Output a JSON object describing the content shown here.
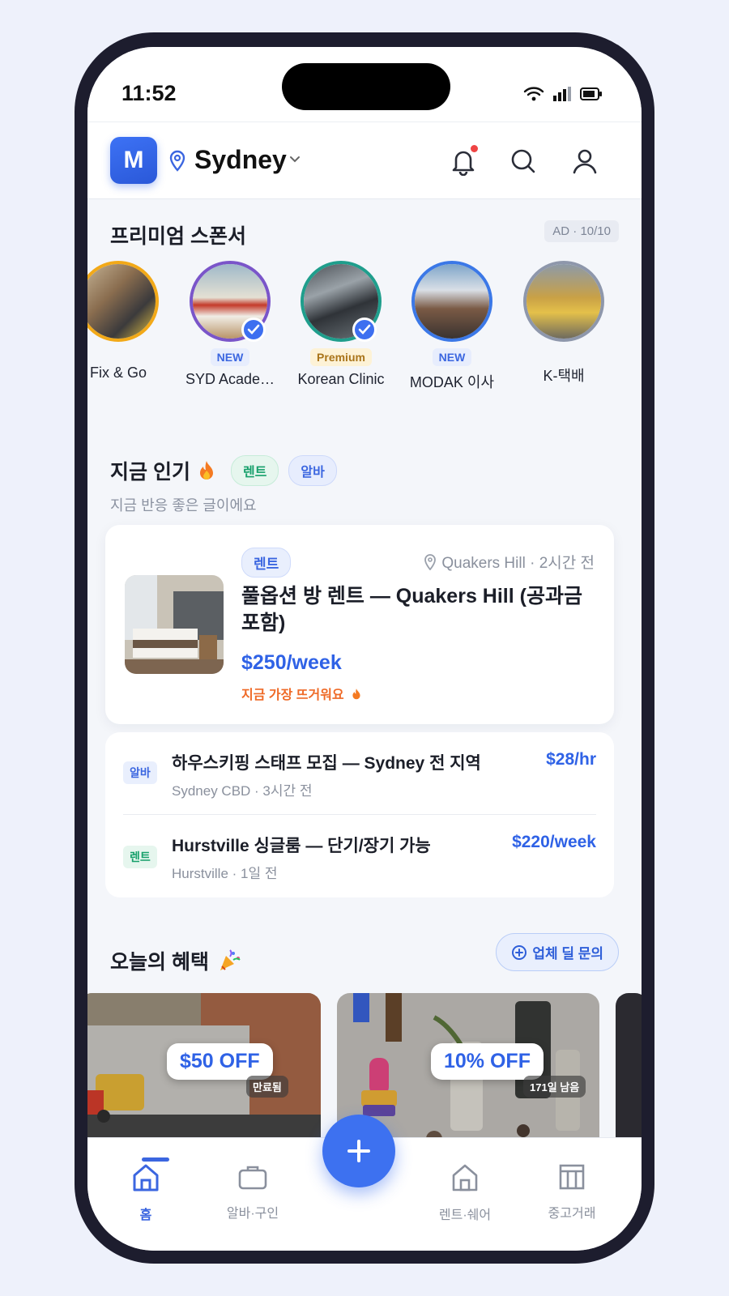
{
  "status_bar": {
    "time": "11:52"
  },
  "header": {
    "logo_letter": "M",
    "city": "Sydney"
  },
  "sponsors": {
    "title": "프리미엄 스폰서",
    "ad_badge": "AD · 10/10",
    "items": [
      {
        "name": "Fix & Go",
        "tag": "",
        "ring": "#f2a918",
        "verified": false
      },
      {
        "name": "SYD Acade…",
        "tag": "NEW",
        "ring": "#7a55c9",
        "verified": true
      },
      {
        "name": "Korean Clinic",
        "tag": "Premium",
        "ring": "#1f9e8c",
        "verified": true
      },
      {
        "name": "MODAK 이사",
        "tag": "NEW",
        "ring": "#3b78e7",
        "verified": false
      },
      {
        "name": "K-택배",
        "tag": "",
        "ring": "#8e97ab",
        "verified": false
      }
    ]
  },
  "popular": {
    "title": "지금 인기",
    "chip_rent": "렌트",
    "chip_alba": "알바",
    "subtitle": "지금 반응 좋은 글이에요",
    "featured": {
      "tag": "렌트",
      "location": "Quakers Hill · 2시간 전",
      "title": "풀옵션 방 렌트 — Quakers Hill (공과금 포함)",
      "price": "$250/week",
      "hot_label": "지금 가장 뜨거워요"
    },
    "list": [
      {
        "tag": "알바",
        "title": "하우스키핑 스태프 모집 — Sydney 전 지역",
        "sub": "Sydney CBD · 3시간 전",
        "price": "$28/hr"
      },
      {
        "tag": "렌트",
        "title": "Hurstville 싱글룸 — 단기/장기 가능",
        "sub": "Hurstville · 1일 전",
        "price": "$220/week"
      }
    ]
  },
  "deals": {
    "title": "오늘의 혜택",
    "inquiry_button": "업체 딜 문의",
    "cards": [
      {
        "offer": "$50 OFF",
        "meta": "만료됨"
      },
      {
        "offer": "10% OFF",
        "meta": "171일 남음"
      }
    ]
  },
  "bottom_nav": {
    "items": [
      {
        "label": "홈",
        "icon": "home-icon",
        "active": true
      },
      {
        "label": "알바·구인",
        "icon": "briefcase-icon",
        "active": false
      },
      {
        "label": "렌트·쉐어",
        "icon": "house-icon",
        "active": false
      },
      {
        "label": "중고거래",
        "icon": "store-icon",
        "active": false
      }
    ]
  },
  "colors": {
    "accent": "#3b66e0",
    "rent": "#17a06b",
    "hot": "#ef6a27",
    "notification": "#ef4444"
  }
}
